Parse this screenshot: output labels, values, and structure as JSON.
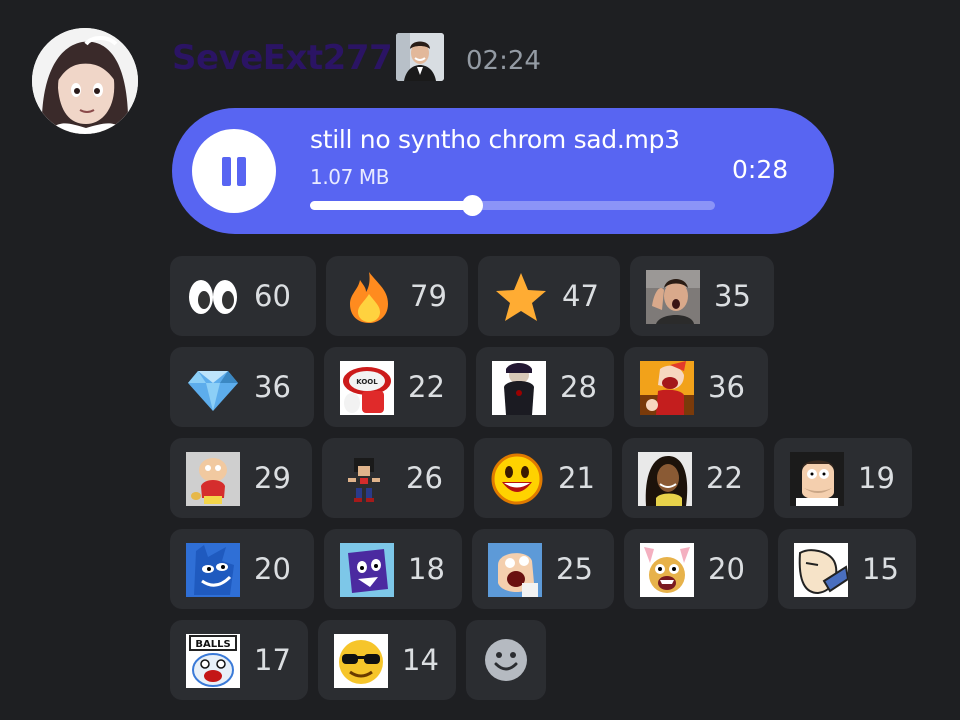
{
  "message": {
    "author": "SeveExt277",
    "timestamp": "02:24",
    "role_icon": "person-portrait-icon",
    "avatar": "anime-girl-avatar",
    "colors": {
      "background": "#1e1f22",
      "author": "#2b1464",
      "timestamp": "#949ba4",
      "player": "#5865f2",
      "reaction_bg": "#2b2d31"
    }
  },
  "audio": {
    "file_name": "still no syntho chrom sad.mp3",
    "file_size": "1.07 MB",
    "time": "0:28",
    "progress": 0.4,
    "state": "playing",
    "control_icon": "pause-icon"
  },
  "reactions": [
    {
      "icon": "eyes-emoji",
      "count": "60"
    },
    {
      "icon": "fire-emoji",
      "count": "79"
    },
    {
      "icon": "star-emoji",
      "count": "47"
    },
    {
      "icon": "shocked-man-emoji",
      "count": "35"
    },
    {
      "icon": "gem-emoji",
      "count": "36"
    },
    {
      "icon": "kool-aid-emoji",
      "count": "22"
    },
    {
      "icon": "dark-character-emoji",
      "count": "28"
    },
    {
      "icon": "laughing-clown-emoji",
      "count": "36"
    },
    {
      "icon": "cartoon-baby-emoji",
      "count": "29"
    },
    {
      "icon": "pixel-fighter-emoji",
      "count": "26"
    },
    {
      "icon": "grinning-face-emoji",
      "count": "21"
    },
    {
      "icon": "curly-hair-man-emoji",
      "count": "22"
    },
    {
      "icon": "cartoon-dad-emoji",
      "count": "19"
    },
    {
      "icon": "blue-creature-emoji",
      "count": "20"
    },
    {
      "icon": "purple-block-emoji",
      "count": "18"
    },
    {
      "icon": "screaming-dad-emoji",
      "count": "25"
    },
    {
      "icon": "panic-character-emoji",
      "count": "20"
    },
    {
      "icon": "sketch-face-emoji",
      "count": "15"
    },
    {
      "icon": "balls-sign-emoji",
      "count": "17"
    },
    {
      "icon": "cool-sunglasses-emoji",
      "count": "14"
    }
  ],
  "add_reaction_icon": "smiley-add-reaction-icon"
}
